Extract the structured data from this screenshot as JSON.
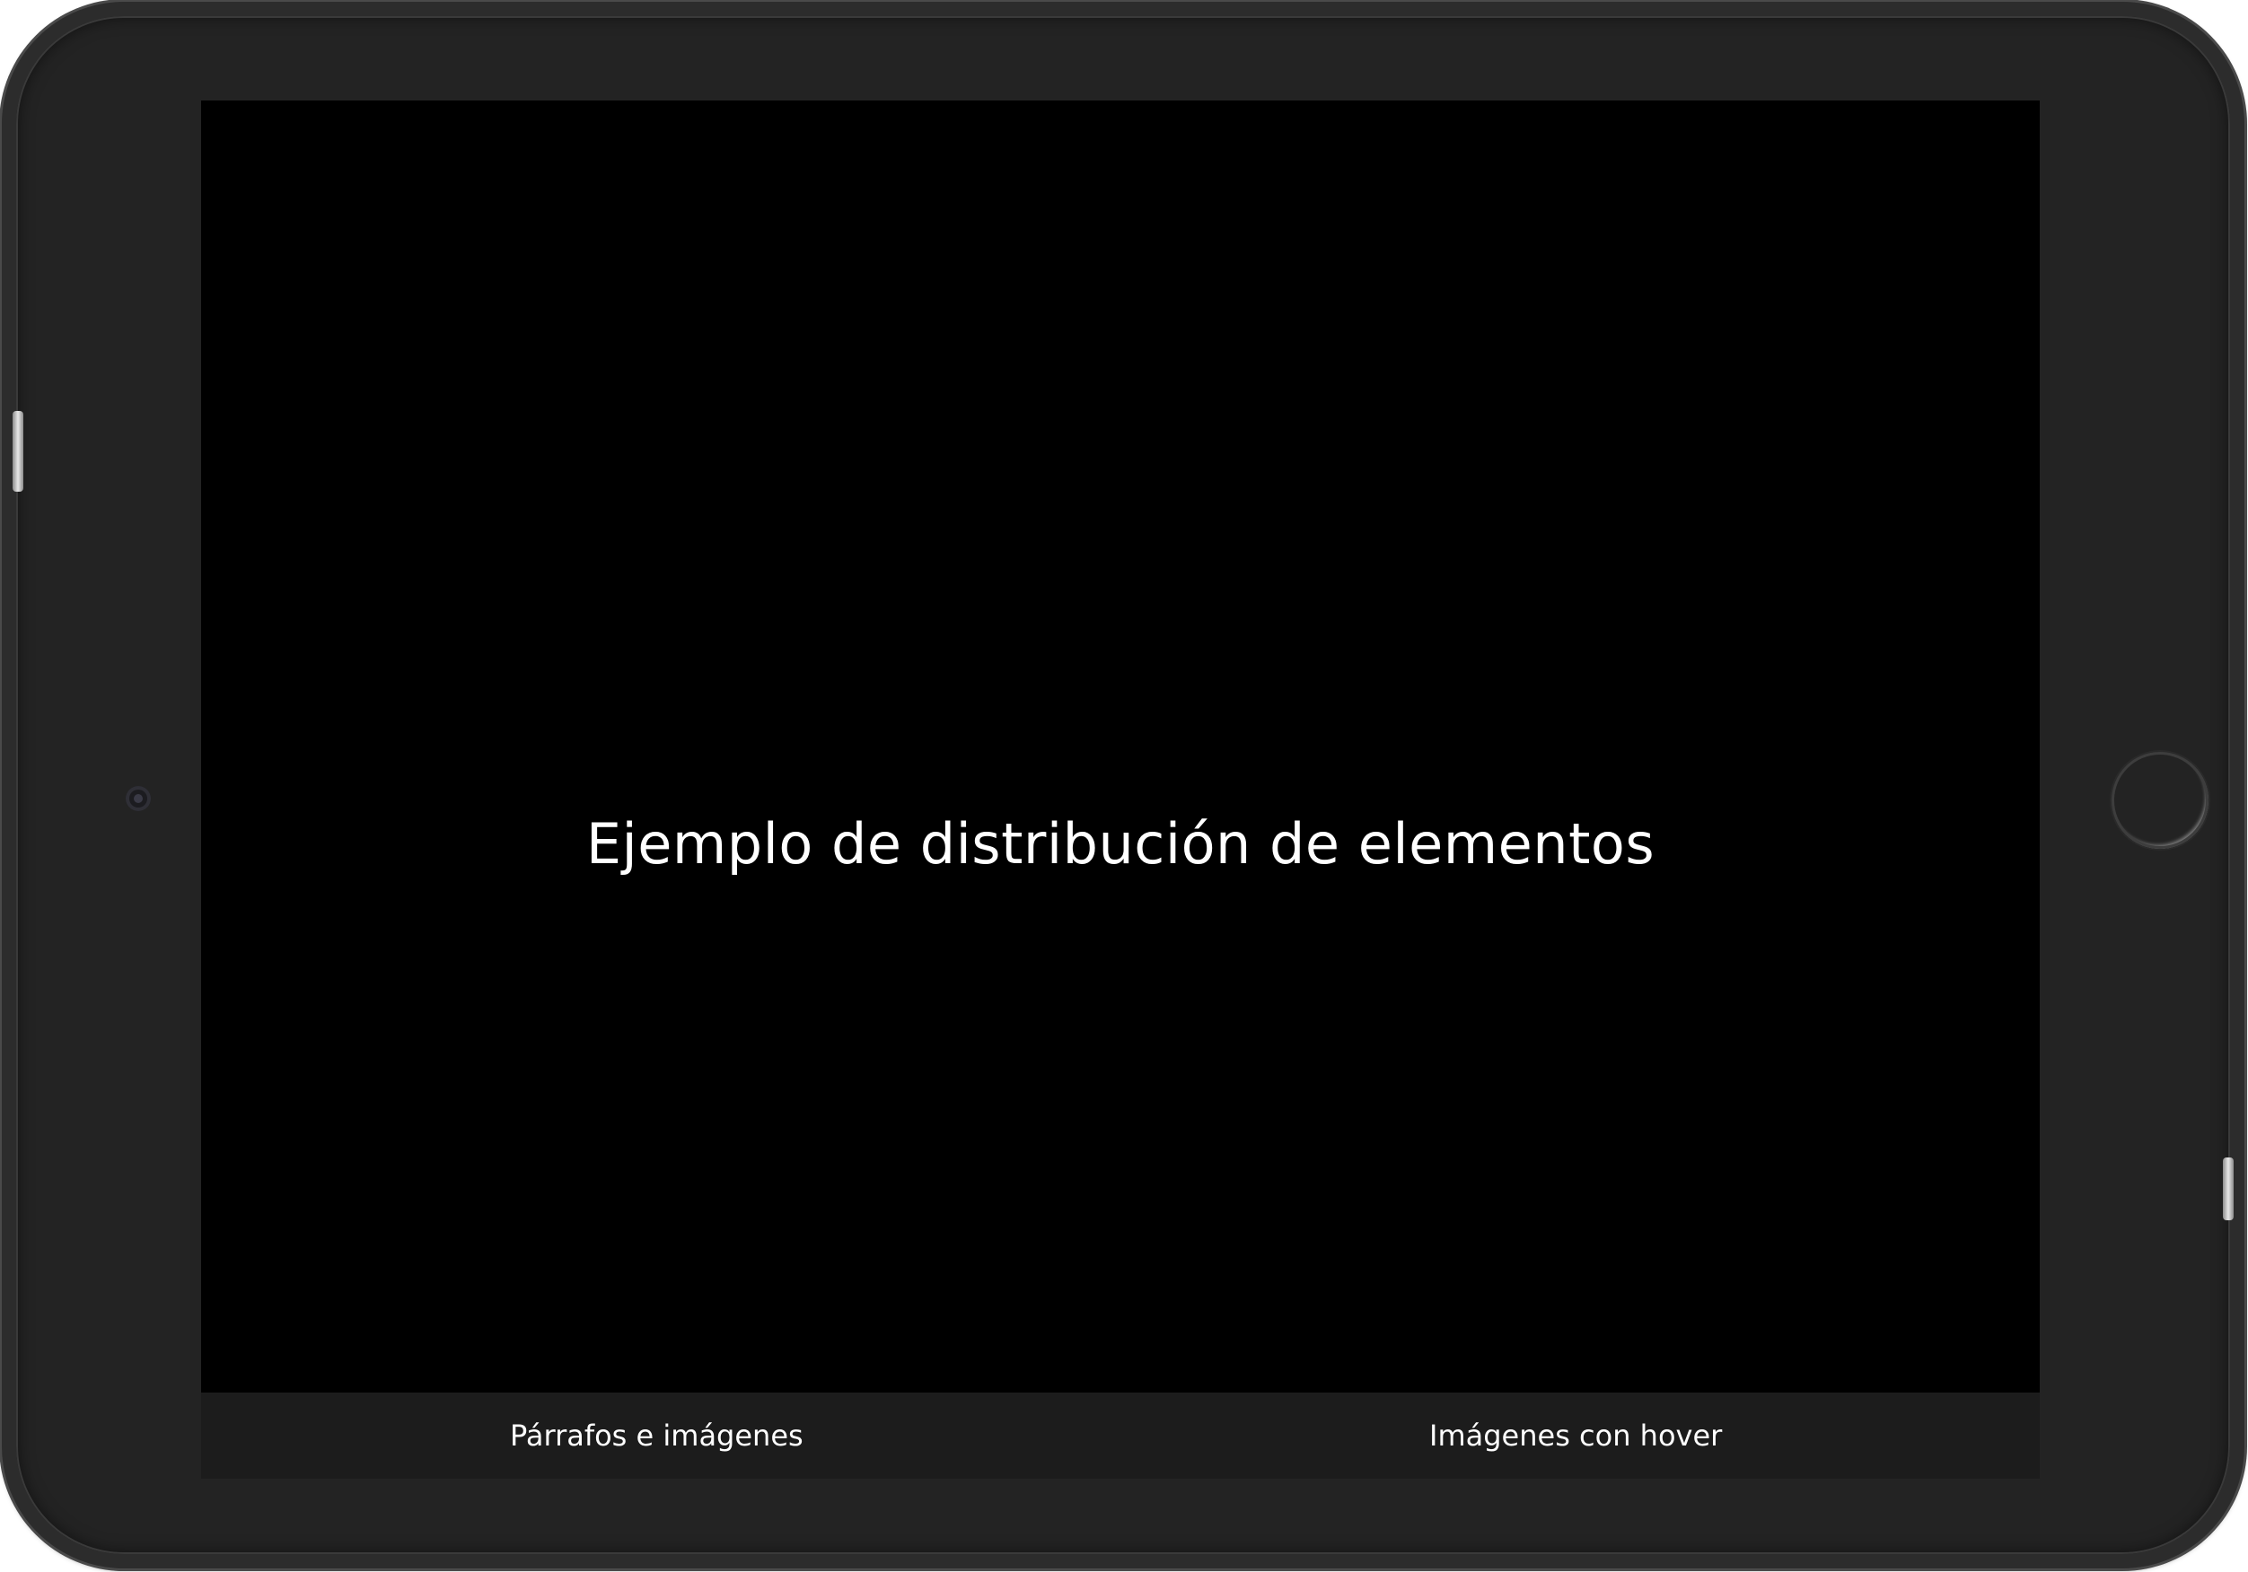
{
  "screen": {
    "title": "Ejemplo de distribución de elementos"
  },
  "bottom_nav": {
    "items": [
      {
        "label": "Párrafos e imágenes"
      },
      {
        "label": "Imágenes con hover"
      }
    ]
  },
  "colors": {
    "device_frame": "#232323",
    "screen_background": "#000000",
    "nav_background": "#1c1c1c",
    "text": "#ffffff"
  },
  "icons": {
    "camera": "camera-icon",
    "home": "home-button-icon"
  }
}
